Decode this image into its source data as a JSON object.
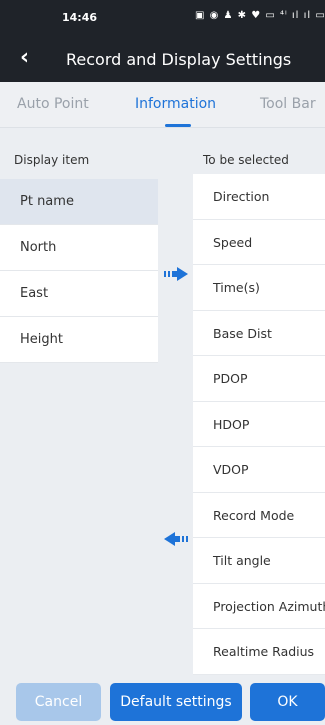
{
  "status_bar": {
    "time": "14:46",
    "icons_text": "▣ ◉ ♟ ✱ ♥ ▭ ⁴ˡ ıl ıl ▭"
  },
  "header": {
    "title": "Record and Display Settings"
  },
  "tabs": [
    {
      "label": "Auto Point"
    },
    {
      "label": "Information"
    },
    {
      "label": "Tool Bar"
    }
  ],
  "active_tab": "Information",
  "columns": {
    "left_header": "Display item",
    "right_header": "To be selected"
  },
  "display_items": [
    {
      "label": "Pt name"
    },
    {
      "label": "North"
    },
    {
      "label": "East"
    },
    {
      "label": "Height"
    }
  ],
  "selected_display_item": "Pt name",
  "available_items": [
    {
      "label": "Direction"
    },
    {
      "label": "Speed"
    },
    {
      "label": "Time(s)"
    },
    {
      "label": "Base Dist"
    },
    {
      "label": "PDOP"
    },
    {
      "label": "HDOP"
    },
    {
      "label": "VDOP"
    },
    {
      "label": "Record Mode"
    },
    {
      "label": "Tilt angle"
    },
    {
      "label": "Projection Azimuth"
    },
    {
      "label": "Realtime Radius"
    }
  ],
  "buttons": {
    "cancel": "Cancel",
    "default": "Default settings",
    "ok": "OK"
  },
  "icons": {
    "back": "chevron-left-icon",
    "move_right": "arrow-right-icon",
    "move_left": "arrow-left-icon"
  },
  "colors": {
    "accent": "#1e73d8",
    "header_bg": "#1f2329",
    "disabled_button": "#a8c7ea",
    "selected_row": "#dfe5ee"
  }
}
